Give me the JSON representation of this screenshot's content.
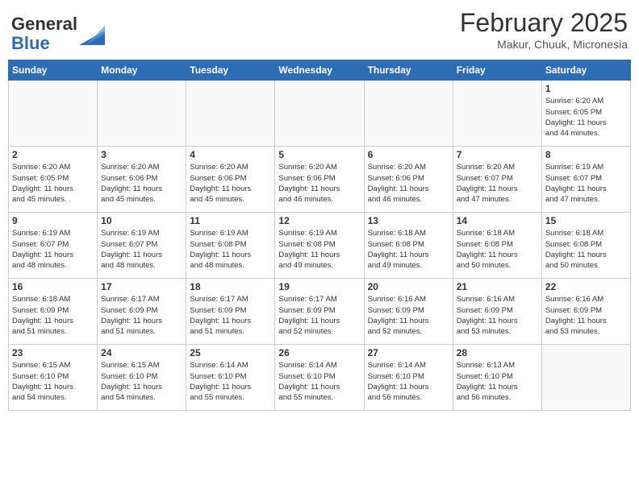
{
  "header": {
    "logo_general": "General",
    "logo_blue": "Blue",
    "month_title": "February 2025",
    "location": "Makur, Chuuk, Micronesia"
  },
  "days_of_week": [
    "Sunday",
    "Monday",
    "Tuesday",
    "Wednesday",
    "Thursday",
    "Friday",
    "Saturday"
  ],
  "weeks": [
    {
      "days": [
        {
          "num": "",
          "info": ""
        },
        {
          "num": "",
          "info": ""
        },
        {
          "num": "",
          "info": ""
        },
        {
          "num": "",
          "info": ""
        },
        {
          "num": "",
          "info": ""
        },
        {
          "num": "",
          "info": ""
        },
        {
          "num": "1",
          "info": "Sunrise: 6:20 AM\nSunset: 6:05 PM\nDaylight: 11 hours\nand 44 minutes."
        }
      ]
    },
    {
      "days": [
        {
          "num": "2",
          "info": "Sunrise: 6:20 AM\nSunset: 6:05 PM\nDaylight: 11 hours\nand 45 minutes."
        },
        {
          "num": "3",
          "info": "Sunrise: 6:20 AM\nSunset: 6:06 PM\nDaylight: 11 hours\nand 45 minutes."
        },
        {
          "num": "4",
          "info": "Sunrise: 6:20 AM\nSunset: 6:06 PM\nDaylight: 11 hours\nand 45 minutes."
        },
        {
          "num": "5",
          "info": "Sunrise: 6:20 AM\nSunset: 6:06 PM\nDaylight: 11 hours\nand 46 minutes."
        },
        {
          "num": "6",
          "info": "Sunrise: 6:20 AM\nSunset: 6:06 PM\nDaylight: 11 hours\nand 46 minutes."
        },
        {
          "num": "7",
          "info": "Sunrise: 6:20 AM\nSunset: 6:07 PM\nDaylight: 11 hours\nand 47 minutes."
        },
        {
          "num": "8",
          "info": "Sunrise: 6:19 AM\nSunset: 6:07 PM\nDaylight: 11 hours\nand 47 minutes."
        }
      ]
    },
    {
      "days": [
        {
          "num": "9",
          "info": "Sunrise: 6:19 AM\nSunset: 6:07 PM\nDaylight: 11 hours\nand 48 minutes."
        },
        {
          "num": "10",
          "info": "Sunrise: 6:19 AM\nSunset: 6:07 PM\nDaylight: 11 hours\nand 48 minutes."
        },
        {
          "num": "11",
          "info": "Sunrise: 6:19 AM\nSunset: 6:08 PM\nDaylight: 11 hours\nand 48 minutes."
        },
        {
          "num": "12",
          "info": "Sunrise: 6:19 AM\nSunset: 6:08 PM\nDaylight: 11 hours\nand 49 minutes."
        },
        {
          "num": "13",
          "info": "Sunrise: 6:18 AM\nSunset: 6:08 PM\nDaylight: 11 hours\nand 49 minutes."
        },
        {
          "num": "14",
          "info": "Sunrise: 6:18 AM\nSunset: 6:08 PM\nDaylight: 11 hours\nand 50 minutes."
        },
        {
          "num": "15",
          "info": "Sunrise: 6:18 AM\nSunset: 6:08 PM\nDaylight: 11 hours\nand 50 minutes."
        }
      ]
    },
    {
      "days": [
        {
          "num": "16",
          "info": "Sunrise: 6:18 AM\nSunset: 6:09 PM\nDaylight: 11 hours\nand 51 minutes."
        },
        {
          "num": "17",
          "info": "Sunrise: 6:17 AM\nSunset: 6:09 PM\nDaylight: 11 hours\nand 51 minutes."
        },
        {
          "num": "18",
          "info": "Sunrise: 6:17 AM\nSunset: 6:09 PM\nDaylight: 11 hours\nand 51 minutes."
        },
        {
          "num": "19",
          "info": "Sunrise: 6:17 AM\nSunset: 6:09 PM\nDaylight: 11 hours\nand 52 minutes."
        },
        {
          "num": "20",
          "info": "Sunrise: 6:16 AM\nSunset: 6:09 PM\nDaylight: 11 hours\nand 52 minutes."
        },
        {
          "num": "21",
          "info": "Sunrise: 6:16 AM\nSunset: 6:09 PM\nDaylight: 11 hours\nand 53 minutes."
        },
        {
          "num": "22",
          "info": "Sunrise: 6:16 AM\nSunset: 6:09 PM\nDaylight: 11 hours\nand 53 minutes."
        }
      ]
    },
    {
      "days": [
        {
          "num": "23",
          "info": "Sunrise: 6:15 AM\nSunset: 6:10 PM\nDaylight: 11 hours\nand 54 minutes."
        },
        {
          "num": "24",
          "info": "Sunrise: 6:15 AM\nSunset: 6:10 PM\nDaylight: 11 hours\nand 54 minutes."
        },
        {
          "num": "25",
          "info": "Sunrise: 6:14 AM\nSunset: 6:10 PM\nDaylight: 11 hours\nand 55 minutes."
        },
        {
          "num": "26",
          "info": "Sunrise: 6:14 AM\nSunset: 6:10 PM\nDaylight: 11 hours\nand 55 minutes."
        },
        {
          "num": "27",
          "info": "Sunrise: 6:14 AM\nSunset: 6:10 PM\nDaylight: 11 hours\nand 56 minutes."
        },
        {
          "num": "28",
          "info": "Sunrise: 6:13 AM\nSunset: 6:10 PM\nDaylight: 11 hours\nand 56 minutes."
        },
        {
          "num": "",
          "info": ""
        }
      ]
    }
  ]
}
